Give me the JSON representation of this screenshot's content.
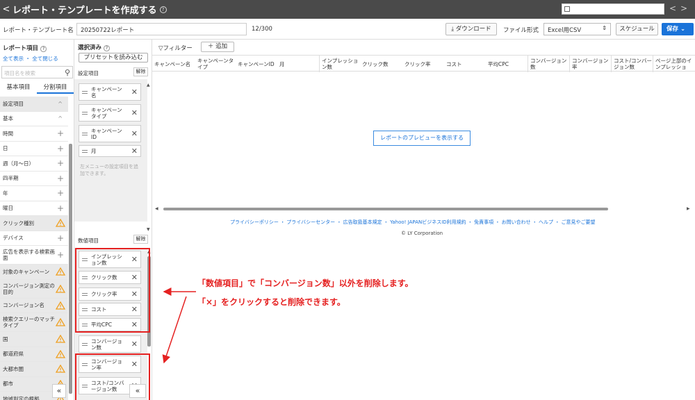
{
  "header": {
    "back": "<",
    "title": "レポート・テンプレートを作成する",
    "help": "?",
    "prev": "<",
    "next": ">"
  },
  "form": {
    "name_label": "レポート・テンプレート名",
    "name_value": "20250722レポート",
    "char_count": "12/300",
    "download": "ダウンロード",
    "format_label": "ファイル形式",
    "format_value": "Excel用CSV",
    "schedule": "スケジュール",
    "save": "保存"
  },
  "left": {
    "title": "レポート項目",
    "help": "?",
    "show_all": "全て表示",
    "close_all": "全て閉じる",
    "search_placeholder": "項目名を検索",
    "tabs": [
      "基本項目",
      "分割項目"
    ],
    "items": [
      {
        "label": "設定項目",
        "type": "gray-caret"
      },
      {
        "label": "基本",
        "type": "caret"
      },
      {
        "label": "時間",
        "type": "plus"
      },
      {
        "label": "日",
        "type": "plus"
      },
      {
        "label": "週（月〜日）",
        "type": "plus"
      },
      {
        "label": "四半期",
        "type": "plus"
      },
      {
        "label": "年",
        "type": "plus"
      },
      {
        "label": "曜日",
        "type": "plus"
      },
      {
        "label": "クリック種別",
        "type": "warn"
      },
      {
        "label": "デバイス",
        "type": "plus"
      },
      {
        "label": "広告を表示する検索画面",
        "type": "plus-tall"
      },
      {
        "label": "対象のキャンペーン",
        "type": "warn"
      },
      {
        "label": "コンバージョン測定の目的",
        "type": "warn-tall"
      },
      {
        "label": "コンバージョン名",
        "type": "warn"
      },
      {
        "label": "検索クエリーのマッチタイプ",
        "type": "warn-tall"
      },
      {
        "label": "国",
        "type": "warn"
      },
      {
        "label": "都道府県",
        "type": "warn"
      },
      {
        "label": "大都市圏",
        "type": "warn"
      },
      {
        "label": "都市",
        "type": "warn"
      },
      {
        "label": "地域判定の根拠",
        "type": "warn"
      }
    ],
    "collapse": "«"
  },
  "selected": {
    "title": "選択済み",
    "help": "?",
    "preset": "プリセットを読み込む",
    "setting_label": "設定項目",
    "clear": "解除",
    "setting_items": [
      "キャンペーン名",
      "キャンペーンタイプ",
      "キャンペーンID",
      "月"
    ],
    "hint": "左メニューの設定項目を追加できます。",
    "metric_label": "数値項目",
    "metric_items": [
      "インプレッション数",
      "クリック数",
      "クリック率",
      "コスト",
      "平均CPC",
      "コンバージョン数",
      "コンバージョン率",
      "コスト/コンバージョン数"
    ],
    "collapse": "«"
  },
  "main": {
    "filter": "フィルター",
    "add": "＋ 追加",
    "columns": [
      "キャンペーン名",
      "キャンペーンタイプ",
      "キャンペーンID",
      "月",
      "インプレッション数",
      "クリック数",
      "クリック率",
      "コスト",
      "平均CPC",
      "コンバージョン数",
      "コンバージョン率",
      "コスト/コンバージョン数",
      "ページ上部のインプレッショ"
    ],
    "preview_button": "レポートのプレビューを表示する",
    "footer_links": "プライバシーポリシー ・ プライバシーセンター ・ 広告取扱基本規定 ・ Yahoo! JAPANビジネスID利用規約 ・ 免責事項 ・ お問い合わせ ・ ヘルプ ・ ご意見やご要望",
    "copyright": "© LY Corporation"
  },
  "annotation": {
    "line1": "「数値項目」で「コンバージョン数」以外を削除します。",
    "line2": "「×」をクリックすると削除できます。",
    "color": "#e52121"
  },
  "colors": {
    "accent": "#1a73d9",
    "topbar": "#4a4a4a",
    "warning": "#f0a020"
  }
}
